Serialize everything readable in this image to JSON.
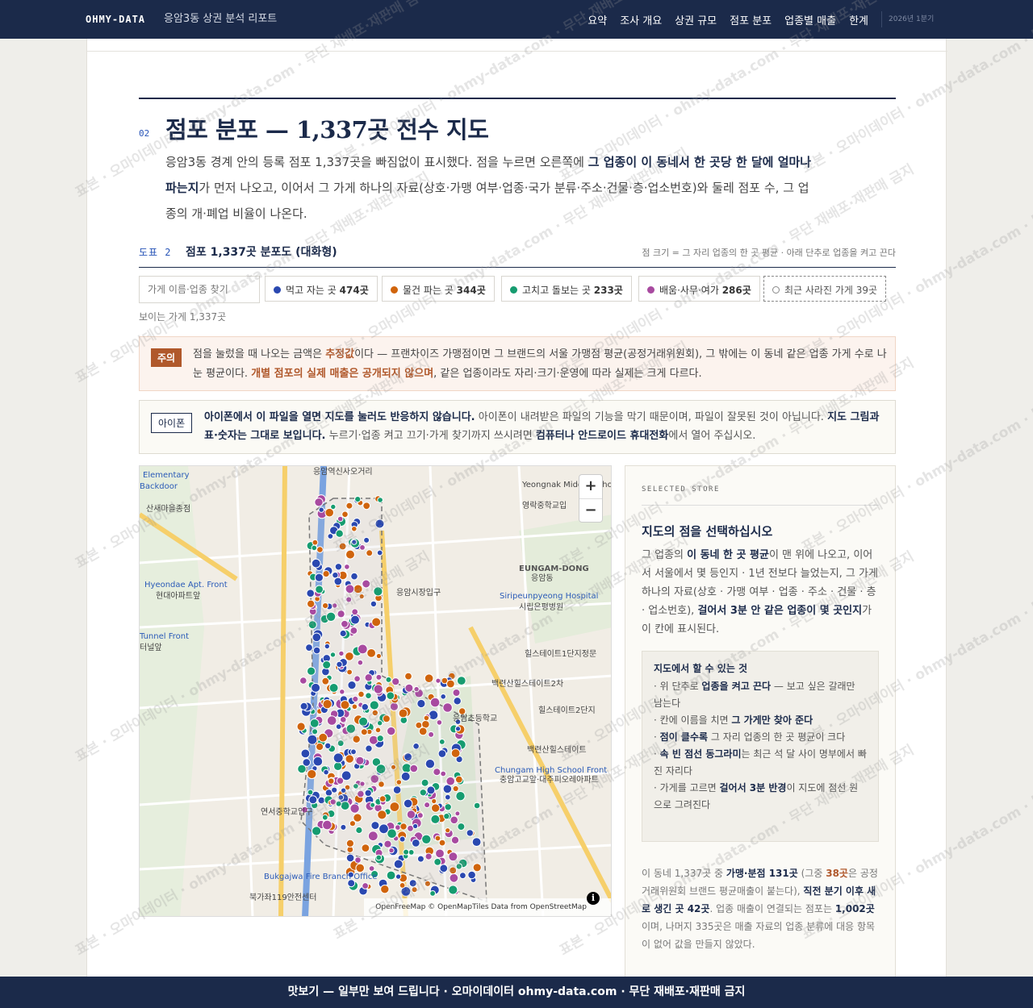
{
  "header": {
    "brand": "OHMY-DATA",
    "subtitle": "응암3동 상권 분석 리포트",
    "nav": [
      "요약",
      "조사 개요",
      "상권 규모",
      "점포 분포",
      "업종별 매출",
      "한계"
    ],
    "period": "2026년 1분기"
  },
  "section": {
    "number": "02",
    "title": "점포 분포 — 1,337곳 전수 지도",
    "lead_1": "응암3동 경계 안의 등록 점포 1,337곳을 빠짐없이 표시했다. 점을 누르면 오른쪽에 ",
    "lead_bold_1": "그 업종이 이 동네서 한 곳당 한 달에 얼마나 파는지",
    "lead_2": "가 먼저 나오고, 이어서 그 가게 하나의 자료(상호·가맹 여부·업종·국가 분류·주소·건물·층·업소번호)와 둘레 점포 수, 그 업종의 개·폐업 비율이 나온다."
  },
  "figure": {
    "label": "도표 2",
    "title": "점포 1,337곳 분포도 (대화형)",
    "note": "점 크기 = 그 자리 업종의 한 곳 평균 · 아래 단추로 업종을 켜고 끈다"
  },
  "filters": {
    "search_placeholder": "가게 이름·업종 찾기",
    "chips": [
      {
        "label": "먹고 자는 곳",
        "count": "474곳",
        "color": "#2a48b0"
      },
      {
        "label": "물건 파는 곳",
        "count": "344곳",
        "color": "#d0640c"
      },
      {
        "label": "고치고 돌보는 곳",
        "count": "233곳",
        "color": "#169c70"
      },
      {
        "label": "배움·사무·여가",
        "count": "286곳",
        "color": "#a84aa0"
      },
      {
        "label": "최근 사라진 가게",
        "count": "39곳",
        "color": "#888888"
      }
    ],
    "visible_count": "보이는 가게 1,337곳"
  },
  "notice": {
    "tag": "주의",
    "text_1": "점을 눌렀을 때 나오는 금액은 ",
    "bold_1": "추정값",
    "text_2": "이다 — 프랜차이즈 가맹점이면 그 브랜드의 서울 가맹점 평균(공정거래위원회), 그 밖에는 이 동네 같은 업종 가게 수로 나눈 평균이다. ",
    "bold_2": "개별 점포의 실제 매출은 공개되지 않으며",
    "text_3": ", 같은 업종이라도 자리·크기·운영에 따라 실제는 크게 다르다."
  },
  "ios": {
    "tag": "아이폰",
    "bold_1": "아이폰에서 이 파일을 열면 지도를 눌러도 반응하지 않습니다.",
    "text_1": " 아이폰이 내려받은 파일의 기능을 막기 때문이며, 파일이 잘못된 것이 아닙니다. ",
    "bold_2": "지도 그림과 표·숫자는 그대로 보입니다.",
    "text_2": " 누르기·업종 켜고 끄기·가게 찾기까지 쓰시려면 ",
    "bold_3": "컴퓨터나 안드로이드 휴대전화",
    "text_3": "에서 열어 주십시오."
  },
  "map": {
    "zoom_in": "+",
    "zoom_out": "−",
    "attribution": "OpenFreeMap © OpenMapTiles Data from OpenStreetMap",
    "labels": [
      "응암역신사오거리",
      "Yeongnak Middle School Entrance",
      "영락중학교입",
      "EUNGAM-DONG",
      "응암동",
      "응암시장입구",
      "Siripeunpyeong Hospital",
      "시립은평병원",
      "힐스테이트1단지정문",
      "백련산힐스테이트2차",
      "응암초등학교",
      "힐스테이트2단지",
      "백련산힐스테이트",
      "Chungam High School Front",
      "충암고교앞·대주피오레아파트",
      "연서중학교입구",
      "Bukgajwa Fire Branch Office",
      "북가좌119안전센터",
      "Hyeondae Apt. Front",
      "현대아파트앞",
      "Tunnel Front",
      "터널앞",
      "산새마을종점",
      "Elementary",
      "Backdoor"
    ]
  },
  "side": {
    "label": "SELECTED STORE",
    "title": "지도의 점을 선택하십시오",
    "p1": "그 업종의 ",
    "p1b": "이 동네 한 곳 평균",
    "p2": "이 맨 위에 나오고, 이어서 서울에서 몇 등인지 · 1년 전보다 늘었는지, 그 가게 하나의 자료(상호 · 가맹 여부 · 업종 · 주소 · 건물 · 층 · 업소번호), ",
    "p2b": "걸어서 3분 안 같은 업종이 몇 곳인지",
    "p3": "가 이 칸에 표시된다.",
    "howto_title": "지도에서 할 수 있는 것",
    "howto_1a": "· 위 단추로 ",
    "howto_1b": "업종을 켜고 끈다",
    "howto_1c": " — 보고 싶은 갈래만 남는다",
    "howto_2a": "· 칸에 이름을 치면 ",
    "howto_2b": "그 가게만 찾아 준다",
    "howto_3a": "· ",
    "howto_3b": "점이 클수록",
    "howto_3c": " 그 자리 업종의 한 곳 평균이 크다",
    "howto_4a": "· ",
    "howto_4b": "속 빈 점선 동그라미",
    "howto_4c": "는 최근 석 달 사이 명부에서 빠진 자리다",
    "howto_5a": "· 가게를 고르면 ",
    "howto_5b": "걸어서 3분 반경",
    "howto_5c": "이 지도에 점선 원으로 그려진다",
    "stats_1": "이 동네 1,337곳 중 ",
    "stats_1b": "가맹·분점 131곳",
    "stats_2": " (그중 ",
    "stats_2b": "38곳",
    "stats_3": "은 공정거래위원회 브랜드 평균매출이 붙는다), ",
    "stats_3b": "직전 분기 이후 새로 생긴 곳 42곳",
    "stats_4": ". 업종 매출이 연결되는 점포는 ",
    "stats_4b": "1,002곳",
    "stats_5": "이며, 나머지 335곳은 매출 자료의 업종 분류에 대응 항목이 없어 값을 만들지 않았다."
  },
  "footer": "맛보기 — 일부만 보여 드립니다 · 오마이데이터 ohmy-data.com · 무단 재배포·재판매 금지",
  "watermark": "표본 · 오마이데이터 · ohmy-data.com · 무단 재배포·재판매 금지"
}
